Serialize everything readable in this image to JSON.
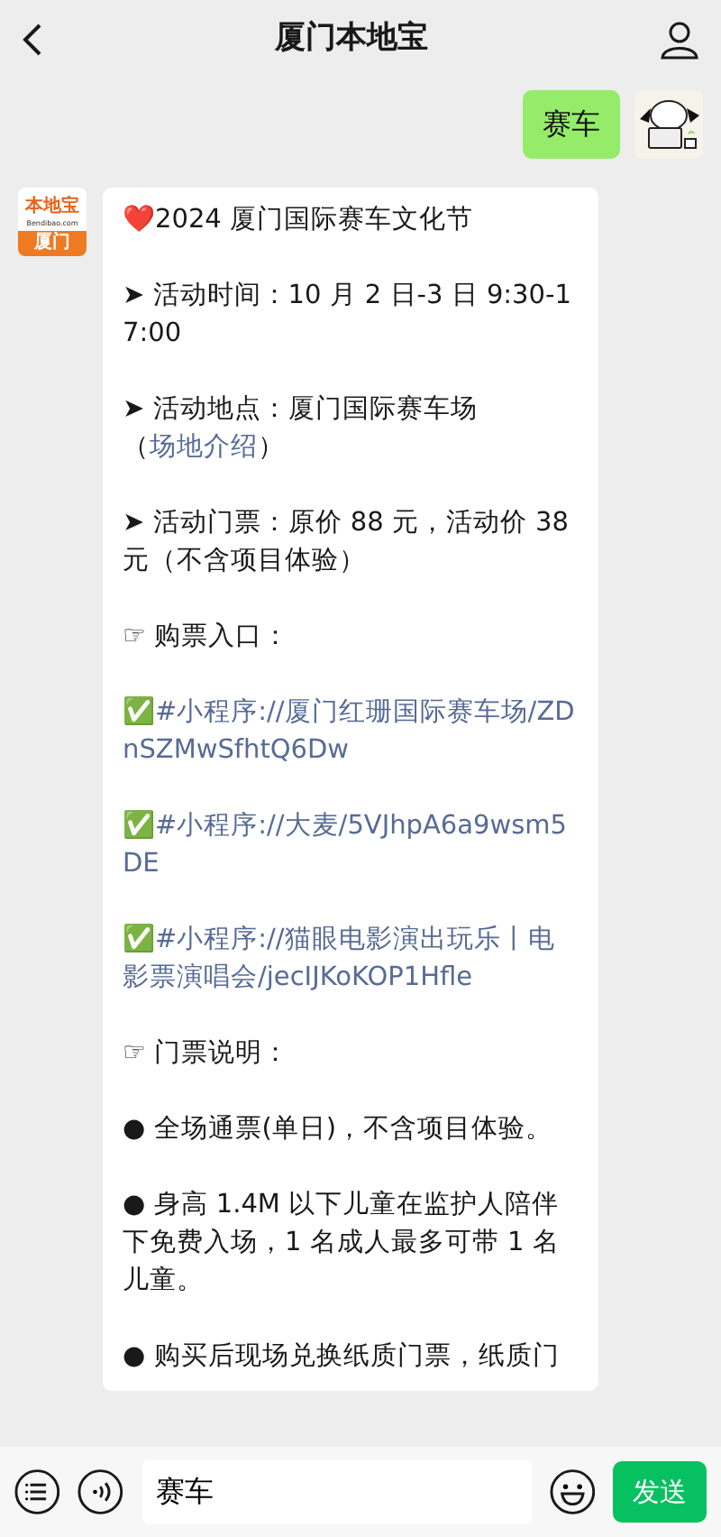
{
  "header": {
    "title": "厦门本地宝"
  },
  "messages": [
    {
      "kind": "sent",
      "text": "赛车"
    },
    {
      "kind": "received",
      "logo": {
        "brand": "本地宝",
        "site": "Bendibao.com",
        "city": "厦门"
      },
      "paragraphs": [
        {
          "kind": "text",
          "text": "❤️2024 厦门国际赛车文化节"
        },
        {
          "kind": "text",
          "text": "➤ 活动时间：10 月 2 日-3 日 9:30-17:00"
        },
        {
          "kind": "inline_link",
          "before": "➤ 活动地点：厦门国际赛车场（",
          "link": "场地介绍",
          "after": "）"
        },
        {
          "kind": "text",
          "text": "➤ 活动门票：原价 88 元，活动价 38 元（不含项目体验）"
        },
        {
          "kind": "text",
          "text": "☞ 购票入口："
        },
        {
          "kind": "link",
          "text": "✅#小程序://厦门红珊国际赛车场/ZDnSZMwSfhtQ6Dw"
        },
        {
          "kind": "link",
          "text": "✅#小程序://大麦/5VJhpA6a9wsm5DE"
        },
        {
          "kind": "link",
          "text": "✅#小程序://猫眼电影演出玩乐丨电影票演唱会/jecIJKoKOP1Hfle"
        },
        {
          "kind": "text",
          "text": "☞ 门票说明："
        },
        {
          "kind": "text",
          "text": "● 全场通票(单日)，不含项目体验。"
        },
        {
          "kind": "text",
          "text": "● 身高 1.4M 以下儿童在监护人陪伴下免费入场，1 名成人最多可带 1 名儿童。"
        },
        {
          "kind": "text",
          "text": "● 购买后现场兑换纸质门票，纸质门"
        }
      ]
    }
  ],
  "input": {
    "value": "赛车"
  },
  "send_button": "发送"
}
